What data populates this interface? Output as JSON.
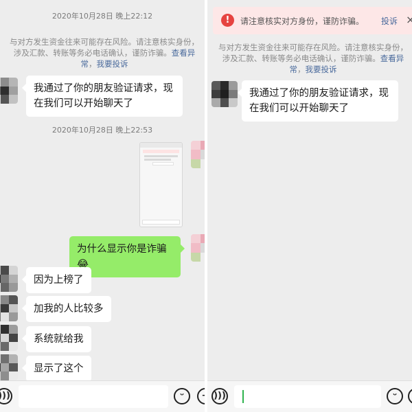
{
  "left": {
    "timestamp_1": "2020年10月28日 晚上22:12",
    "notice": {
      "text": "与对方发生资金往来可能存在风险。请注意核实身份，涉及汇款、转账等务必电话确认，谨防诈骗。",
      "link_1": "查看异常",
      "link_2": "我要投诉"
    },
    "msg_friend_added": "我通过了你的朋友验证请求，现在我们可以开始聊天了",
    "timestamp_2": "2020年10月28日 晚上22:53",
    "msg_question": "为什么显示你是诈骗",
    "msg_question_emoji": "😂",
    "replies": [
      "因为上榜了",
      "加我的人比较多",
      "系统就给我",
      "显示了这个"
    ]
  },
  "right": {
    "warning_banner": {
      "icon": "!",
      "text": "请注意核实对方身份，谨防诈骗。",
      "complain": "投诉",
      "close": "×"
    },
    "notice": {
      "text": "与对方发生资金往来可能存在风险。请注意核实身份，涉及汇款、转账等务必电话确认，谨防诈骗。",
      "link_1": "查看异常",
      "link_2": "我要投诉"
    },
    "msg_friend_added": "我通过了你的朋友验证请求，现在我们可以开始聊天了"
  },
  "toolbar": {
    "voice_icon": "voice-icon",
    "emoji_icon": "emoji-icon",
    "plus_icon": "plus-icon"
  },
  "colors": {
    "chat_background": "#ededed",
    "sent_bubble": "#95ec69",
    "received_bubble": "#ffffff",
    "warning_red": "#e64340",
    "link_blue": "#4a6a9c"
  }
}
